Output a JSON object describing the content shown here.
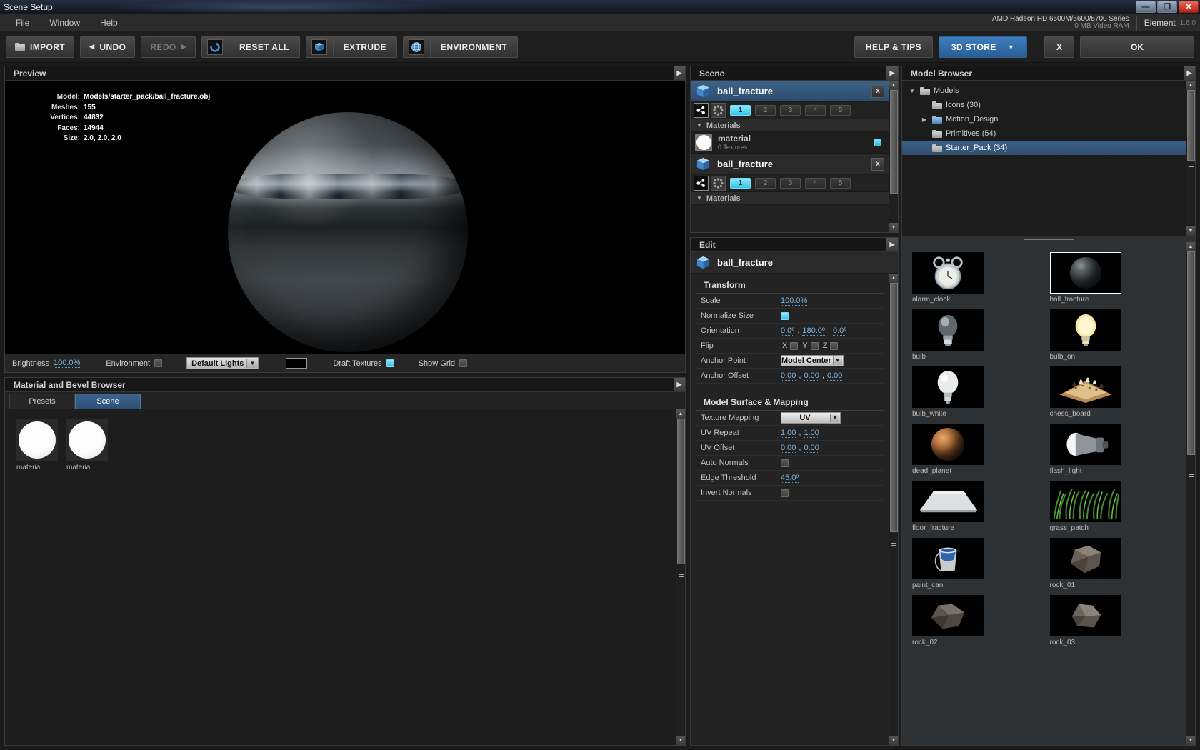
{
  "window": {
    "title": "Scene Setup",
    "buttons": {
      "minimize": "—",
      "maximize": "❐",
      "close": "✕"
    }
  },
  "menu": {
    "items": [
      "File",
      "Window",
      "Help"
    ]
  },
  "gpu": {
    "line1": "AMD Radeon HD 6500M/5600/5700 Series",
    "line2": "0 MB Video RAM",
    "product": "Element",
    "version": "1.6.0"
  },
  "toolbar": {
    "import": "IMPORT",
    "undo": "UNDO",
    "redo": "REDO",
    "reset_all": "RESET ALL",
    "extrude": "EXTRUDE",
    "environment": "ENVIRONMENT",
    "help_tips": "HELP & TIPS",
    "store": "3D STORE",
    "cancel": "X",
    "ok": "OK",
    "accent": "#3d7dbd"
  },
  "preview": {
    "title": "Preview",
    "info": [
      {
        "key": "Model:",
        "value": "Models/starter_pack/ball_fracture.obj"
      },
      {
        "key": "Meshes:",
        "value": "155"
      },
      {
        "key": "Vertices:",
        "value": "44832"
      },
      {
        "key": "Faces:",
        "value": "14944"
      },
      {
        "key": "Size:",
        "value": "2.0, 2.0, 2.0"
      }
    ],
    "controls": {
      "brightness_label": "Brightness",
      "brightness_value": "100.0%",
      "environment_label": "Environment",
      "environment_checked": false,
      "lights_preset": "Default Lights",
      "color_swatch": "#000000",
      "draft_textures_label": "Draft Textures",
      "draft_textures_checked": true,
      "show_grid_label": "Show Grid",
      "show_grid_checked": false
    }
  },
  "material_browser": {
    "title": "Material and Bevel Browser",
    "tabs": [
      {
        "label": "Presets",
        "active": false
      },
      {
        "label": "Scene",
        "active": true
      }
    ],
    "items": [
      {
        "name": "material"
      },
      {
        "name": "material"
      }
    ]
  },
  "scene": {
    "title": "Scene",
    "objects": [
      {
        "name": "ball_fracture",
        "selected": true,
        "close": "x",
        "slots": [
          "1",
          "2",
          "3",
          "4",
          "5"
        ],
        "active_slot": "1",
        "materials_label": "Materials",
        "materials": [
          {
            "name": "material",
            "textures": "0 Textures"
          }
        ]
      },
      {
        "name": "ball_fracture",
        "selected": false,
        "close": "x",
        "slots": [
          "1",
          "2",
          "3",
          "4",
          "5"
        ],
        "active_slot": "1",
        "materials_label": "Materials",
        "materials": []
      }
    ]
  },
  "edit": {
    "title": "Edit",
    "object_name": "ball_fracture",
    "sections": [
      {
        "title": "Transform",
        "rows": [
          {
            "label": "Scale",
            "type": "value",
            "value": "100.0%"
          },
          {
            "label": "Normalize Size",
            "type": "check",
            "checked": true
          },
          {
            "label": "Orientation",
            "type": "triple",
            "values": [
              "0.0º",
              "180.0º",
              "0.0º"
            ]
          },
          {
            "label": "Flip",
            "type": "axes",
            "axes": [
              {
                "axis": "X",
                "checked": false
              },
              {
                "axis": "Y",
                "checked": false
              },
              {
                "axis": "Z",
                "checked": false
              }
            ]
          },
          {
            "label": "Anchor Point",
            "type": "dropdown",
            "value": "Model Center"
          },
          {
            "label": "Anchor Offset",
            "type": "triple",
            "values": [
              "0.00",
              "0.00",
              "0.00"
            ]
          }
        ]
      },
      {
        "title": "Model Surface & Mapping",
        "rows": [
          {
            "label": "Texture Mapping",
            "type": "dropdown",
            "value": "UV"
          },
          {
            "label": "UV Repeat",
            "type": "pair",
            "values": [
              "1.00",
              "1.00"
            ]
          },
          {
            "label": "UV Offset",
            "type": "pair",
            "values": [
              "0.00",
              "0.00"
            ]
          },
          {
            "label": "Auto Normals",
            "type": "check",
            "checked": false
          },
          {
            "label": "Edge Threshold",
            "type": "value",
            "value": "45.0º"
          },
          {
            "label": "Invert Normals",
            "type": "check",
            "checked": false
          }
        ]
      }
    ]
  },
  "model_browser": {
    "title": "Model Browser",
    "tree": [
      {
        "label": "Models",
        "arrow": "▼",
        "depth": 0,
        "folder": "grey",
        "selected": false
      },
      {
        "label": "Icons (30)",
        "arrow": "",
        "depth": 1,
        "folder": "grey",
        "selected": false
      },
      {
        "label": "Motion_Design",
        "arrow": "▶",
        "depth": 1,
        "folder": "blue",
        "selected": false
      },
      {
        "label": "Primitives (54)",
        "arrow": "",
        "depth": 1,
        "folder": "grey",
        "selected": false
      },
      {
        "label": "Starter_Pack (34)",
        "arrow": "",
        "depth": 1,
        "folder": "grey",
        "selected": true
      }
    ],
    "thumbnails": [
      {
        "name": "alarm_clock",
        "kind": "clock",
        "selected": false
      },
      {
        "name": "ball_fracture",
        "kind": "darkball",
        "selected": true
      },
      {
        "name": "bulb",
        "kind": "bulb",
        "selected": false
      },
      {
        "name": "bulb_on",
        "kind": "bulbon",
        "selected": false
      },
      {
        "name": "bulb_white",
        "kind": "bulbw",
        "selected": false
      },
      {
        "name": "chess_board",
        "kind": "chess",
        "selected": false
      },
      {
        "name": "dead_planet",
        "kind": "planet",
        "selected": false
      },
      {
        "name": "flash_light",
        "kind": "flash",
        "selected": false
      },
      {
        "name": "floor_fracture",
        "kind": "floor",
        "selected": false
      },
      {
        "name": "grass_patch",
        "kind": "grass",
        "selected": false
      },
      {
        "name": "paint_can",
        "kind": "paint",
        "selected": false
      },
      {
        "name": "rock_01",
        "kind": "rock",
        "selected": false
      },
      {
        "name": "rock_02",
        "kind": "rock",
        "selected": false
      },
      {
        "name": "rock_03",
        "kind": "rock",
        "selected": false
      }
    ]
  }
}
